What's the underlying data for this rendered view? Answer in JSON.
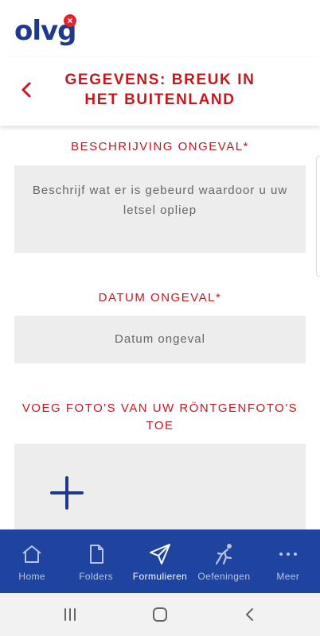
{
  "logo": {
    "text": "olvg",
    "badge": "×",
    "brand_color": "#1f3a8a",
    "badge_color": "#e0262b"
  },
  "header": {
    "title": "GEGEVENS: BREUK IN HET BUITENLAND",
    "back_icon": "chevron-left-icon",
    "accent": "#c8161d"
  },
  "form": {
    "description_label": "BESCHRIJVING ONGEVAL*",
    "description_placeholder": "Beschrijf wat er is gebeurd waardoor u uw letsel opliep",
    "date_label": "DATUM ONGEVAL*",
    "date_placeholder": "Datum ongeval",
    "photos_label": "VOEG FOTO'S VAN UW RÖNTGENFOTO'S TOE",
    "add_icon": "plus-icon"
  },
  "bottom_nav": {
    "background": "#1f44a0",
    "items": [
      {
        "label": "Home",
        "icon": "home-icon",
        "active": false
      },
      {
        "label": "Folders",
        "icon": "document-icon",
        "active": false
      },
      {
        "label": "Formulieren",
        "icon": "send-icon",
        "active": true
      },
      {
        "label": "Oefeningen",
        "icon": "exercise-icon",
        "active": false
      },
      {
        "label": "Meer",
        "icon": "more-icon",
        "active": false
      }
    ]
  },
  "system_nav": {
    "icons": [
      "recent-apps-icon",
      "home-circle-icon",
      "back-icon"
    ]
  }
}
